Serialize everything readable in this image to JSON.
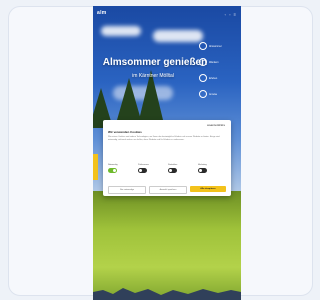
{
  "header": {
    "logo": "alm",
    "icons": [
      "search-icon",
      "phone-icon",
      "menu-icon"
    ]
  },
  "hero": {
    "title": "Almsommer genießen",
    "subtitle": "im Kärntner Mölltal"
  },
  "side_links": [
    {
      "label": "Almsommer",
      "icon": "circle-icon"
    },
    {
      "label": "Wandern",
      "icon": "circle-icon"
    },
    {
      "label": "Erleben",
      "icon": "circle-icon"
    },
    {
      "label": "Anreise",
      "icon": "circle-icon"
    }
  ],
  "cookie_banner": {
    "brand": "usercentrics",
    "title": "Wir verwenden Cookies",
    "text": "Wir nutzen Cookies und andere Technologien, um Ihnen das bestmögliche Erlebnis auf unserer Website zu bieten. Einige sind notwendig, während andere uns helfen, diese Website und Ihr Erlebnis zu verbessern.",
    "toggles": [
      {
        "label": "Notwendig",
        "enabled": true
      },
      {
        "label": "Präferenzen",
        "enabled": false
      },
      {
        "label": "Statistiken",
        "enabled": false
      },
      {
        "label": "Marketing",
        "enabled": false
      }
    ],
    "buttons": {
      "deny": "Nur notwendige",
      "save": "Auswahl speichern",
      "accept": "Alle akzeptieren"
    }
  }
}
